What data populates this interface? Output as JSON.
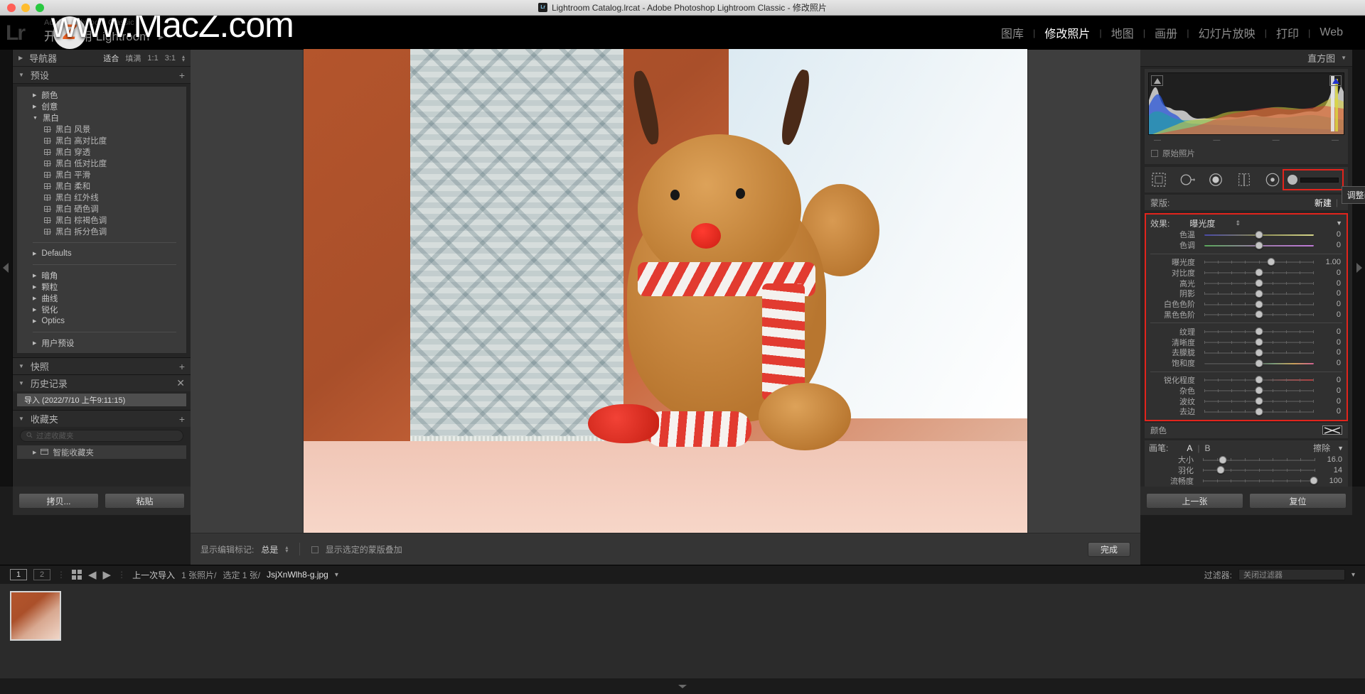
{
  "window": {
    "title": "Lightroom Catalog.lrcat - Adobe Photoshop Lightroom Classic - 修改照片",
    "app_badge": "Lr"
  },
  "watermark": {
    "text": "www.MacZ.com",
    "badge": "Z"
  },
  "brand": {
    "logo": "Lr",
    "superscript": "Adobe Lightroom Classic",
    "main": "开始使用 Lightroom",
    "arrow": "▶"
  },
  "modules": {
    "separator": "|",
    "items": [
      {
        "label": "图库",
        "active": false
      },
      {
        "label": "修改照片",
        "active": true
      },
      {
        "label": "地图",
        "active": false
      },
      {
        "label": "画册",
        "active": false
      },
      {
        "label": "幻灯片放映",
        "active": false
      },
      {
        "label": "打印",
        "active": false
      },
      {
        "label": "Web",
        "active": false
      }
    ]
  },
  "left_panel": {
    "navigator": {
      "title": "导航器",
      "triangle": "▶",
      "zoom_options": [
        "适合",
        "填满",
        "1:1",
        "3:1"
      ],
      "selected_zoom": "适合"
    },
    "presets": {
      "title": "预设",
      "triangle": "▼",
      "plus": "+",
      "groups": [
        {
          "label": "颜色",
          "expanded": false,
          "triangle": "▶",
          "items": []
        },
        {
          "label": "创意",
          "expanded": false,
          "triangle": "▶",
          "items": []
        },
        {
          "label": "黑白",
          "expanded": true,
          "triangle": "▼",
          "items": [
            "黑白 风景",
            "黑白 高对比度",
            "黑白 穿透",
            "黑白 低对比度",
            "黑白 平滑",
            "黑白 柔和",
            "黑白 红外线",
            "黑白 硒色调",
            "黑白 棕褐色调",
            "黑白 拆分色调"
          ]
        },
        {
          "label": "Defaults",
          "expanded": false,
          "triangle": "▶",
          "items": []
        },
        {
          "label": "暗角",
          "expanded": false,
          "triangle": "▶",
          "items": []
        },
        {
          "label": "颗粒",
          "expanded": false,
          "triangle": "▶",
          "items": []
        },
        {
          "label": "曲线",
          "expanded": false,
          "triangle": "▶",
          "items": []
        },
        {
          "label": "锐化",
          "expanded": false,
          "triangle": "▶",
          "items": []
        },
        {
          "label": "Optics",
          "expanded": false,
          "triangle": "▶",
          "items": []
        },
        {
          "label": "用户预设",
          "expanded": false,
          "triangle": "▶",
          "items": []
        }
      ]
    },
    "snapshots": {
      "title": "快照",
      "triangle": "▼",
      "plus": "+"
    },
    "history": {
      "title": "历史记录",
      "triangle": "▼",
      "clear": "✕",
      "entries": [
        "导入 (2022/7/10 上午9:11:15)"
      ]
    },
    "collections": {
      "title": "收藏夹",
      "triangle": "▼",
      "plus": "+",
      "filter_placeholder": "过滤收藏夹",
      "search_icon": "search-icon",
      "items": [
        "智能收藏夹"
      ]
    },
    "buttons": {
      "copy": "拷贝...",
      "paste": "粘贴"
    }
  },
  "center": {
    "toolbar": {
      "edit_marks_label": "显示编辑标记:",
      "edit_marks_value": "总是",
      "overlay_label": "显示选定的蒙版叠加",
      "overlay_checked": false,
      "done": "完成"
    }
  },
  "right_panel": {
    "histogram": {
      "title": "直方图",
      "triangle": "▼",
      "original_label": "原始照片",
      "original_checked": false,
      "ticks": [
        "—",
        "—",
        "—",
        "—"
      ]
    },
    "tools": [
      {
        "name": "crop-tool",
        "label": "裁剪叠加"
      },
      {
        "name": "spot-removal-tool",
        "label": "污点去除"
      },
      {
        "name": "red-eye-tool",
        "label": "红眼校正"
      },
      {
        "name": "graduated-filter-tool",
        "label": "渐变滤镜"
      },
      {
        "name": "radial-filter-tool",
        "label": "径向滤镜"
      },
      {
        "name": "adjustment-brush-tool",
        "label": "调整画笔",
        "active": true
      }
    ],
    "tooltip": "调整画笔 (K)",
    "mask": {
      "label": "蒙版:",
      "new": "新建",
      "separator": "|"
    },
    "effects": {
      "label": "效果:",
      "preset": "曝光度",
      "stepper": "⇕",
      "triangle": "▼",
      "groups": [
        {
          "sliders": [
            {
              "label": "色温",
              "value": "0",
              "pos": 50,
              "track": "temp"
            },
            {
              "label": "色调",
              "value": "0",
              "pos": 50,
              "track": "tint"
            }
          ]
        },
        {
          "sliders": [
            {
              "label": "曝光度",
              "value": "1.00",
              "pos": 60,
              "track": "plain"
            },
            {
              "label": "对比度",
              "value": "0",
              "pos": 50,
              "track": "plain"
            },
            {
              "label": "高光",
              "value": "0",
              "pos": 50,
              "track": "plain"
            },
            {
              "label": "阴影",
              "value": "0",
              "pos": 50,
              "track": "plain"
            },
            {
              "label": "白色色阶",
              "value": "0",
              "pos": 50,
              "track": "plain"
            },
            {
              "label": "黑色色阶",
              "value": "0",
              "pos": 50,
              "track": "plain"
            }
          ]
        },
        {
          "sliders": [
            {
              "label": "纹理",
              "value": "0",
              "pos": 50,
              "track": "plain"
            },
            {
              "label": "清晰度",
              "value": "0",
              "pos": 50,
              "track": "plain"
            },
            {
              "label": "去朦胧",
              "value": "0",
              "pos": 50,
              "track": "plain"
            },
            {
              "label": "饱和度",
              "value": "0",
              "pos": 50,
              "track": "sat"
            }
          ]
        },
        {
          "sliders": [
            {
              "label": "锐化程度",
              "value": "0",
              "pos": 50,
              "track": "sharp"
            },
            {
              "label": "杂色",
              "value": "0",
              "pos": 50,
              "track": "plain"
            },
            {
              "label": "波纹",
              "value": "0",
              "pos": 50,
              "track": "plain"
            },
            {
              "label": "去边",
              "value": "0",
              "pos": 50,
              "track": "plain"
            }
          ]
        }
      ],
      "highlight_color": "#e2241c"
    },
    "color": {
      "label": "颜色",
      "swatch_icon": "no-color-swatch"
    },
    "brush": {
      "label": "画笔:",
      "a": "A",
      "b": "B",
      "separator": "|",
      "erase": "擦除",
      "triangle": "▼",
      "sliders": [
        {
          "label": "大小",
          "value": "16.0",
          "pos": 20
        },
        {
          "label": "羽化",
          "value": "14",
          "pos": 18
        },
        {
          "label": "流畅度",
          "value": "100",
          "pos": 95
        }
      ]
    },
    "buttons": {
      "previous": "上一张",
      "reset": "复位"
    }
  },
  "filmstrip": {
    "id_boxes": [
      "1",
      "2"
    ],
    "grid_icon": "grid-icon",
    "back_icon": "back-arrow-icon",
    "forward_icon": "forward-arrow-icon",
    "source": "上一次导入",
    "count": "1 张照片/",
    "selected": "选定 1 张/",
    "filename": "JsjXnWlh8-g.jpg",
    "caret": "▾",
    "filter_label": "过滤器:",
    "filter_value": "关闭过滤器",
    "filter_caret": "▾"
  }
}
